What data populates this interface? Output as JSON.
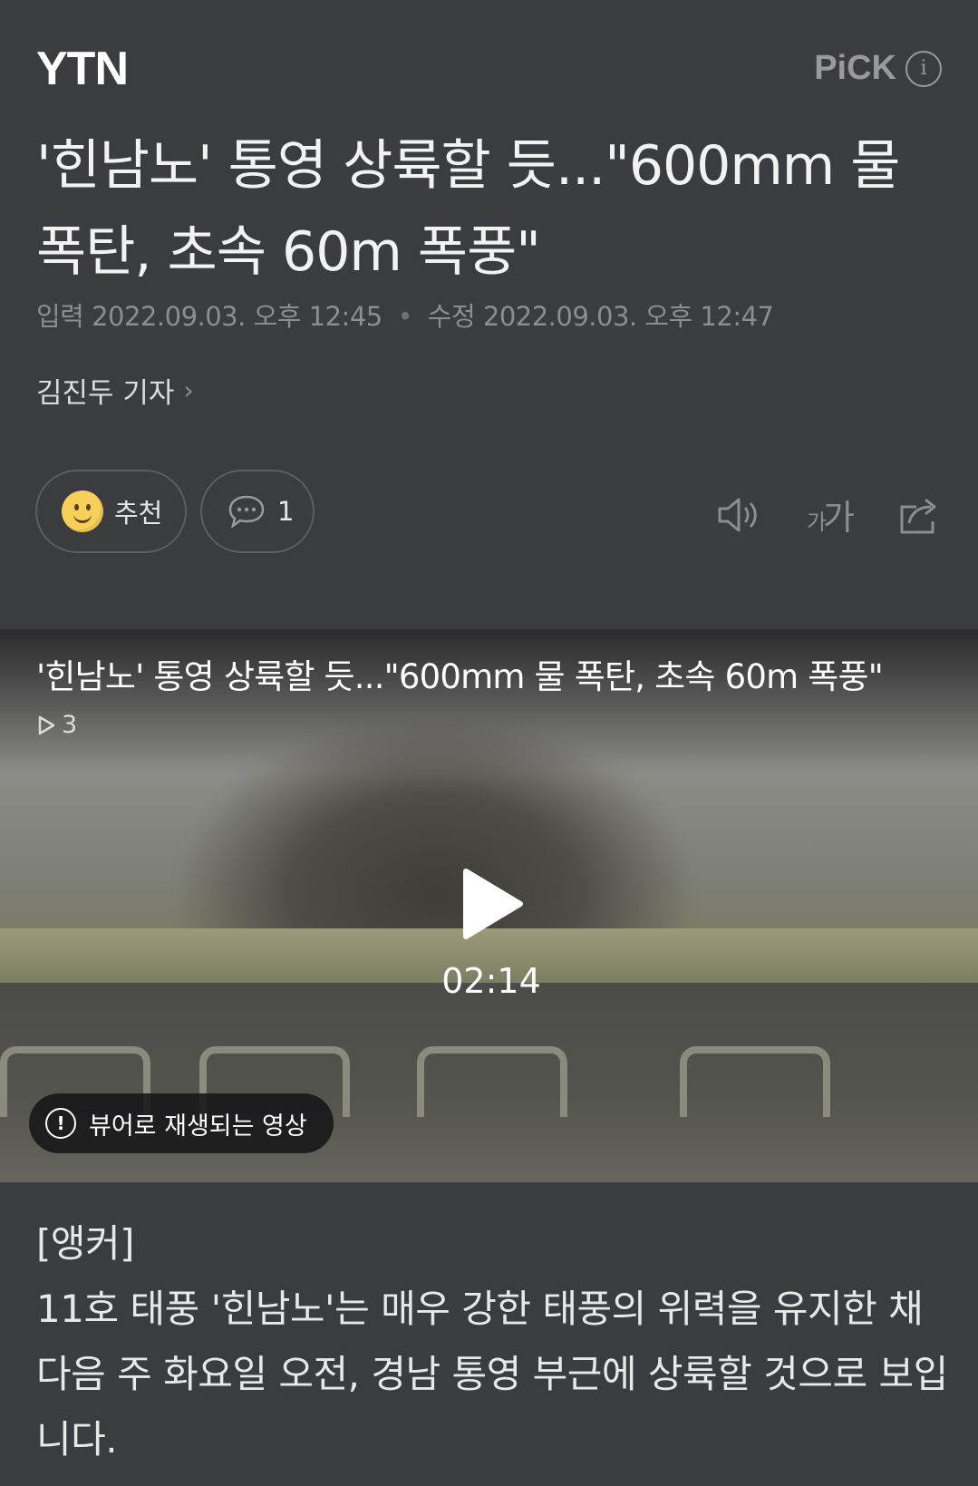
{
  "press": {
    "logo": "YTN",
    "pick_label": "PiCK",
    "pick_info_icon": "i"
  },
  "article": {
    "headline": "'힌남노' 통영 상륙할 듯...\"600mm 물 폭탄, 초속 60m 폭풍\"",
    "input_label": "입력",
    "input_time": "2022.09.03. 오후 12:45",
    "modified_label": "수정",
    "modified_time": "2022.09.03. 오후 12:47",
    "reporter": "김진두 기자"
  },
  "actions": {
    "recommend_label": "추천",
    "comment_count": "1",
    "font_small": "가",
    "font_large": "가"
  },
  "video": {
    "title": "'힌남노' 통영 상륙할 듯...\"600mm 물 폭탄, 초속 60m 폭풍\"",
    "view_count": "3",
    "duration": "02:14",
    "viewer_note": "뷰어로 재생되는 영상"
  },
  "body": {
    "anchor_label": "[앵커]",
    "paragraph": "11호 태풍 '힌남노'는 매우 강한 태풍의 위력을 유지한 채 다음 주 화요일 오전, 경남 통영 부근에 상륙할 것으로 보입니다."
  }
}
